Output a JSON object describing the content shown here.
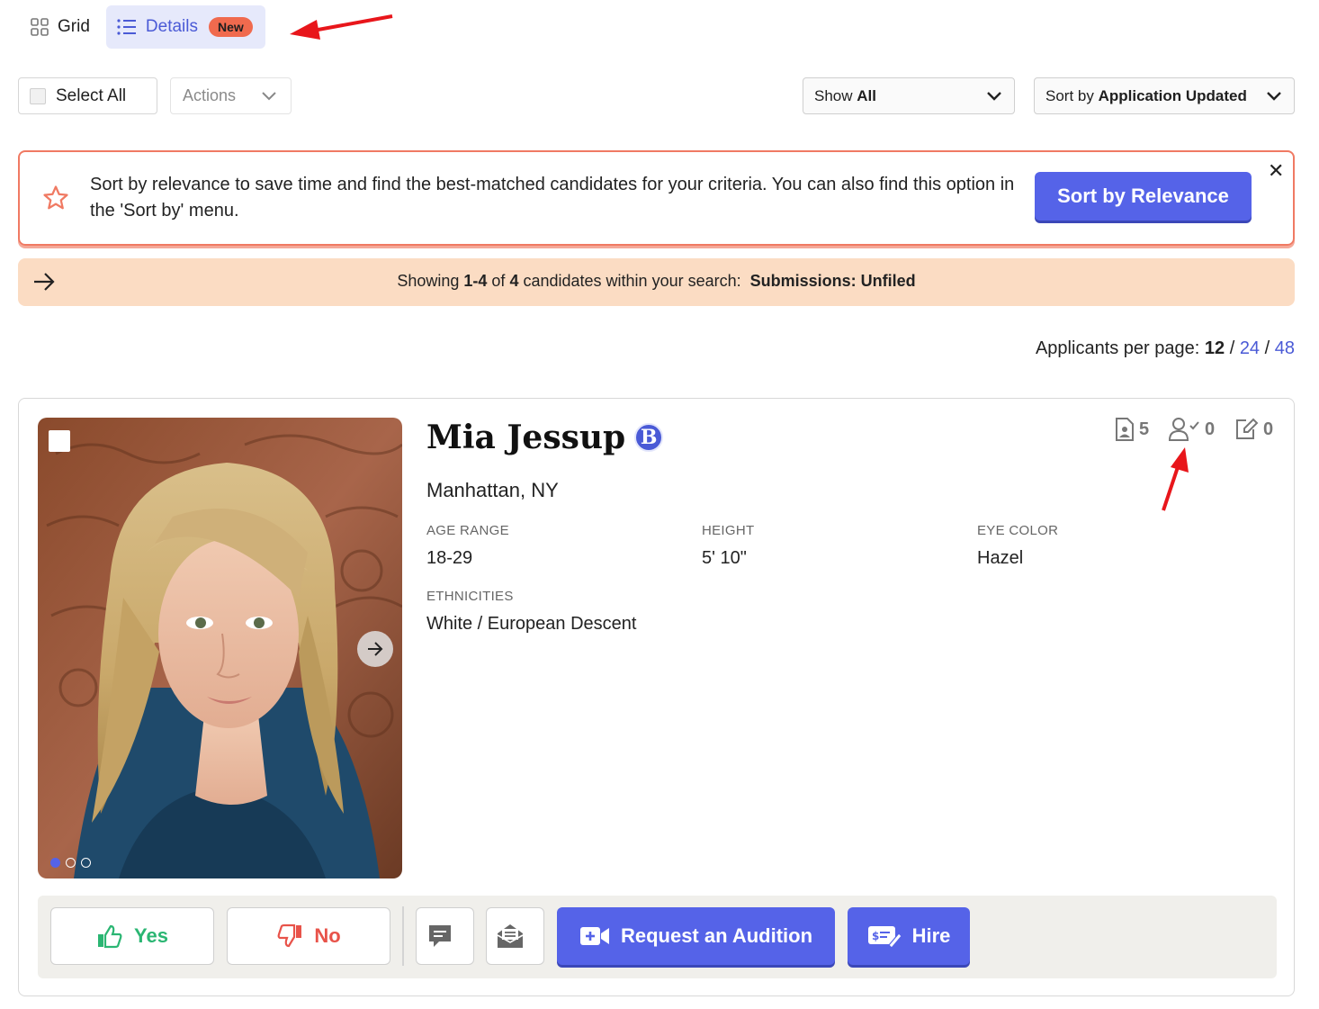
{
  "view_toggle": {
    "grid_label": "Grid",
    "details_label": "Details",
    "new_badge": "New"
  },
  "toolbar": {
    "select_all_label": "Select All",
    "actions_label": "Actions",
    "show_prefix": "Show",
    "show_value": "All",
    "sort_prefix": "Sort by",
    "sort_value": "Application Updated"
  },
  "relevance_banner": {
    "message": "Sort by relevance to save time and find the best-matched candidates for your criteria. You can also find this option in the 'Sort by' menu.",
    "button_label": "Sort by Relevance",
    "close_glyph": "✕"
  },
  "results_strip": {
    "showing": "Showing",
    "range": "1-4",
    "of": "of",
    "total": "4",
    "suffix": "candidates within your search:",
    "filter": "Submissions: Unfiled"
  },
  "per_page": {
    "label": "Applicants per page:",
    "current": "12",
    "options": [
      "24",
      "48"
    ],
    "separator": "/"
  },
  "candidate": {
    "name": "Mia Jessup",
    "badge_letter": "B",
    "location": "Manhattan, NY",
    "attributes": [
      {
        "label": "AGE RANGE",
        "value": "18-29"
      },
      {
        "label": "HEIGHT",
        "value": "5' 10\""
      },
      {
        "label": "EYE COLOR",
        "value": "Hazel"
      },
      {
        "label": "ETHNICITIES",
        "value": "White / European Descent"
      }
    ],
    "stats": {
      "media_count": "5",
      "reviewed_count": "0",
      "notes_count": "0"
    },
    "photo_dots": 3,
    "photo_active_index": 0
  },
  "action_bar": {
    "yes_label": "Yes",
    "no_label": "No",
    "audition_label": "Request an Audition",
    "hire_label": "Hire"
  },
  "colors": {
    "accent": "#5563e8",
    "banner_border": "#f07a63",
    "strip_bg": "#fbdcc3",
    "yes": "#2bb673",
    "no": "#e8534a",
    "annotation_arrow": "#e8161b"
  }
}
